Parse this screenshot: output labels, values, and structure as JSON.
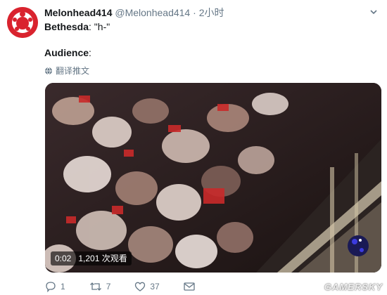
{
  "tweet": {
    "display_name": "Melonhead414",
    "handle": "@Melonhead414",
    "separator": "·",
    "time": "2小时",
    "line1_speaker": "Bethesda",
    "line1_text": ": \"h-\"",
    "line2_speaker": "Audience",
    "line2_text": ":",
    "translate_label": "翻译推文",
    "icons": {
      "avatar": "red-logo-avatar",
      "menu": "chevron-down-icon",
      "translate": "globe-icon"
    }
  },
  "media": {
    "duration": "0:02",
    "views": "1,201 次观看",
    "watermark": "GAMERSKY"
  },
  "actions": {
    "reply_count": "1",
    "retweet_count": "7",
    "like_count": "37",
    "icons": {
      "reply": "reply-icon",
      "retweet": "retweet-icon",
      "like": "heart-icon",
      "message": "envelope-icon"
    }
  },
  "colors": {
    "accent": "#1da1f2",
    "muted": "#657786",
    "avatar_red": "#d9232e"
  }
}
